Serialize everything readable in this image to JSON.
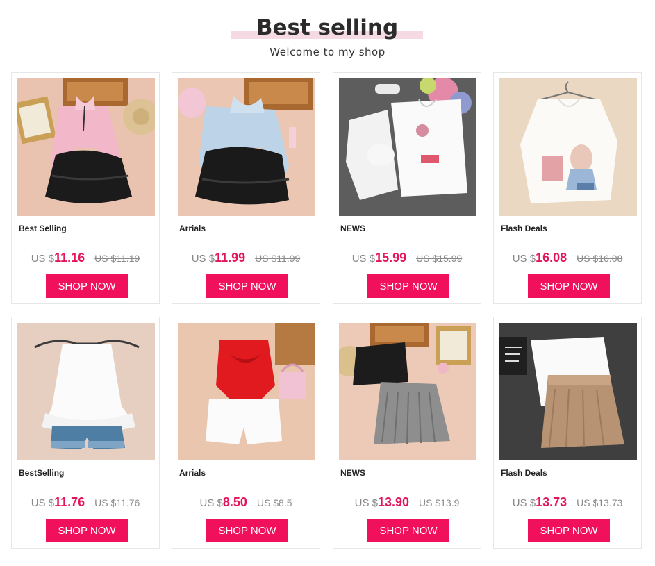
{
  "header": {
    "title": "Best selling",
    "subtitle": "Welcome to my shop"
  },
  "colors": {
    "accent": "#f0105b",
    "price": "#e4145a",
    "title_band": "#f5d9e3"
  },
  "products": [
    {
      "name": "Best Selling",
      "currency": "US $",
      "price": "11.16",
      "old_price": "US $11.19",
      "button": "SHOP NOW",
      "image": "pink-blouse-black-tutu-skirt"
    },
    {
      "name": "Arrials",
      "currency": "US $",
      "price": "11.99",
      "old_price": "US $11.99",
      "button": "SHOP NOW",
      "image": "blue-blouse-black-tutu-skirt"
    },
    {
      "name": "NEWS",
      "currency": "US $",
      "price": "15.99",
      "old_price": "US $15.99",
      "button": "SHOP NOW",
      "image": "white-printed-shirts"
    },
    {
      "name": "Flash Deals",
      "currency": "US $",
      "price": "16.08",
      "old_price": "US $16.08",
      "button": "SHOP NOW",
      "image": "white-bunny-shirt"
    },
    {
      "name": "BestSelling",
      "currency": "US $",
      "price": "11.76",
      "old_price": "US $11.76",
      "button": "SHOP NOW",
      "image": "white-ruffle-top-denim-shorts"
    },
    {
      "name": "Arrials",
      "currency": "US $",
      "price": "8.50",
      "old_price": "US $8.5",
      "button": "SHOP NOW",
      "image": "red-bow-top-white-shorts"
    },
    {
      "name": "NEWS",
      "currency": "US $",
      "price": "13.90",
      "old_price": "US $13.9",
      "button": "SHOP NOW",
      "image": "black-and-grey-pleated-skirts"
    },
    {
      "name": "Flash Deals",
      "currency": "US $",
      "price": "13.73",
      "old_price": "US $13.73",
      "button": "SHOP NOW",
      "image": "white-shirt-khaki-pleated-skirt"
    }
  ]
}
